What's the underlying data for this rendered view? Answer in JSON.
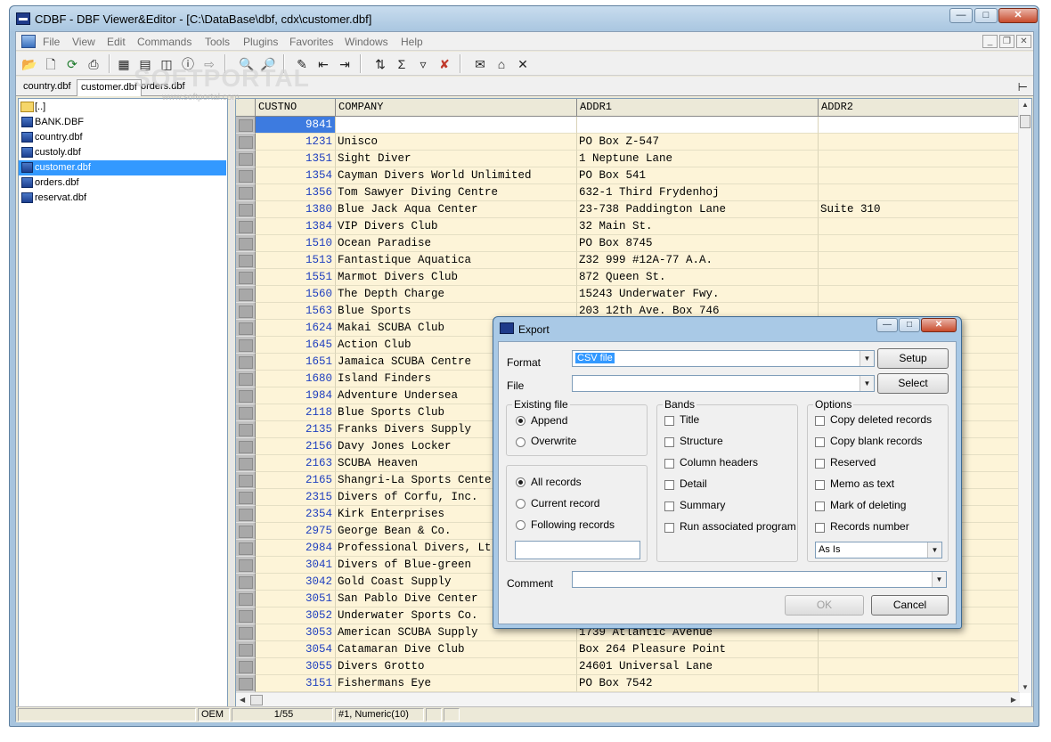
{
  "window": {
    "title": "CDBF - DBF Viewer&Editor - [C:\\DataBase\\dbf, cdx\\customer.dbf]"
  },
  "menu": [
    "File",
    "View",
    "Edit",
    "Commands",
    "Tools",
    "Plugins",
    "Favorites",
    "Windows",
    "Help"
  ],
  "toolbar_icons": [
    "open-icon",
    "new-icon",
    "refresh-icon",
    "print-icon",
    "table-view-icon",
    "form-view-icon",
    "browse-icon",
    "info-icon",
    "go-icon",
    "find-icon",
    "find-next-icon",
    "edit-record-icon",
    "insert-record-icon",
    "append-record-icon",
    "sort-icon",
    "sum-icon",
    "filter-icon",
    "clear-filter-icon",
    "mail-icon",
    "home-icon",
    "close-icon"
  ],
  "tabs": [
    {
      "label": "country.dbf",
      "active": false
    },
    {
      "label": "customer.dbf",
      "active": true
    },
    {
      "label": "orders.dbf",
      "active": false
    }
  ],
  "files": [
    {
      "name": "[..]",
      "type": "folder",
      "selected": false
    },
    {
      "name": "BANK.DBF",
      "type": "file",
      "selected": false
    },
    {
      "name": "country.dbf",
      "type": "file",
      "selected": false
    },
    {
      "name": "custoly.dbf",
      "type": "file",
      "selected": false
    },
    {
      "name": "customer.dbf",
      "type": "file",
      "selected": true
    },
    {
      "name": "orders.dbf",
      "type": "file",
      "selected": false
    },
    {
      "name": "reservat.dbf",
      "type": "file",
      "selected": false
    }
  ],
  "grid": {
    "columns": [
      "CUSTNO",
      "COMPANY",
      "ADDR1",
      "ADDR2"
    ],
    "rows": [
      [
        "9841",
        "",
        "",
        ""
      ],
      [
        "1231",
        "Unisco",
        "PO Box Z-547",
        ""
      ],
      [
        "1351",
        "Sight Diver",
        "1 Neptune Lane",
        ""
      ],
      [
        "1354",
        "Cayman Divers World Unlimited",
        "PO Box 541",
        ""
      ],
      [
        "1356",
        "Tom Sawyer Diving Centre",
        "632-1 Third Frydenhoj",
        ""
      ],
      [
        "1380",
        "Blue Jack Aqua Center",
        "23-738 Paddington Lane",
        "Suite 310"
      ],
      [
        "1384",
        "VIP Divers Club",
        "32 Main St.",
        ""
      ],
      [
        "1510",
        "Ocean Paradise",
        "PO Box 8745",
        ""
      ],
      [
        "1513",
        "Fantastique Aquatica",
        "Z32 999 #12A-77 A.A.",
        ""
      ],
      [
        "1551",
        "Marmot Divers Club",
        "872 Queen St.",
        ""
      ],
      [
        "1560",
        "The Depth Charge",
        "15243 Underwater Fwy.",
        ""
      ],
      [
        "1563",
        "Blue Sports",
        "203 12th Ave. Box 746",
        ""
      ],
      [
        "1624",
        "Makai SCUBA Club",
        "",
        ""
      ],
      [
        "1645",
        "Action Club",
        "",
        ""
      ],
      [
        "1651",
        "Jamaica SCUBA Centre",
        "",
        ""
      ],
      [
        "1680",
        "Island Finders",
        "",
        ""
      ],
      [
        "1984",
        "Adventure Undersea",
        "",
        ""
      ],
      [
        "2118",
        "Blue Sports Club",
        "",
        ""
      ],
      [
        "2135",
        "Franks Divers Supply",
        "",
        ""
      ],
      [
        "2156",
        "Davy Jones Locker",
        "",
        ""
      ],
      [
        "2163",
        "SCUBA Heaven",
        "",
        ""
      ],
      [
        "2165",
        "Shangri-La Sports Cente",
        "",
        ""
      ],
      [
        "2315",
        "Divers of Corfu, Inc.",
        "",
        ""
      ],
      [
        "2354",
        "Kirk Enterprises",
        "",
        ""
      ],
      [
        "2975",
        "George Bean & Co.",
        "",
        ""
      ],
      [
        "2984",
        "Professional Divers, Lt",
        "",
        ""
      ],
      [
        "3041",
        "Divers of Blue-green",
        "",
        ""
      ],
      [
        "3042",
        "Gold Coast Supply",
        "",
        ""
      ],
      [
        "3051",
        "San Pablo Dive Center",
        "",
        ""
      ],
      [
        "3052",
        "Underwater Sports Co.",
        "",
        ""
      ],
      [
        "3053",
        "American SCUBA Supply",
        "1739 Atlantic Avenue",
        ""
      ],
      [
        "3054",
        "Catamaran Dive Club",
        "Box 264 Pleasure Point",
        ""
      ],
      [
        "3055",
        "Divers Grotto",
        "24601 Universal Lane",
        ""
      ],
      [
        "3151",
        "Fishermans Eye",
        "PO Box 7542",
        ""
      ]
    ]
  },
  "status": {
    "encoding": "OEM",
    "position": "1/55",
    "field": "#1, Numeric(10)"
  },
  "watermark": {
    "text": "SOFTPORTAL",
    "sub": "www.softportal.com"
  },
  "dialog": {
    "title": "Export",
    "format_label": "Format",
    "format_value": "CSV file",
    "setup_label": "Setup",
    "file_label": "File",
    "file_value": "",
    "select_label": "Select",
    "existing_file": {
      "title": "Existing file",
      "options": [
        {
          "label": "Append",
          "checked": true
        },
        {
          "label": "Overwrite",
          "checked": false
        }
      ]
    },
    "records": {
      "options": [
        {
          "label": "All records",
          "checked": true
        },
        {
          "label": "Current record",
          "checked": false
        },
        {
          "label": "Following records",
          "checked": false
        }
      ],
      "count_value": ""
    },
    "bands": {
      "title": "Bands",
      "options": [
        {
          "label": "Title",
          "checked": false
        },
        {
          "label": "Structure",
          "checked": false
        },
        {
          "label": "Column headers",
          "checked": false
        },
        {
          "label": "Detail",
          "checked": false
        },
        {
          "label": "Summary",
          "checked": false
        },
        {
          "label": "Run associated program",
          "checked": false
        }
      ]
    },
    "options": {
      "title": "Options",
      "options": [
        {
          "label": "Copy deleted records",
          "checked": false
        },
        {
          "label": "Copy blank records",
          "checked": false
        },
        {
          "label": "Reserved",
          "checked": false
        },
        {
          "label": "Memo as text",
          "checked": false
        },
        {
          "label": "Mark of deleting",
          "checked": false
        },
        {
          "label": "Records number",
          "checked": false
        }
      ],
      "codepage_value": "As Is"
    },
    "comment_label": "Comment",
    "comment_value": "",
    "ok_label": "OK",
    "cancel_label": "Cancel"
  }
}
